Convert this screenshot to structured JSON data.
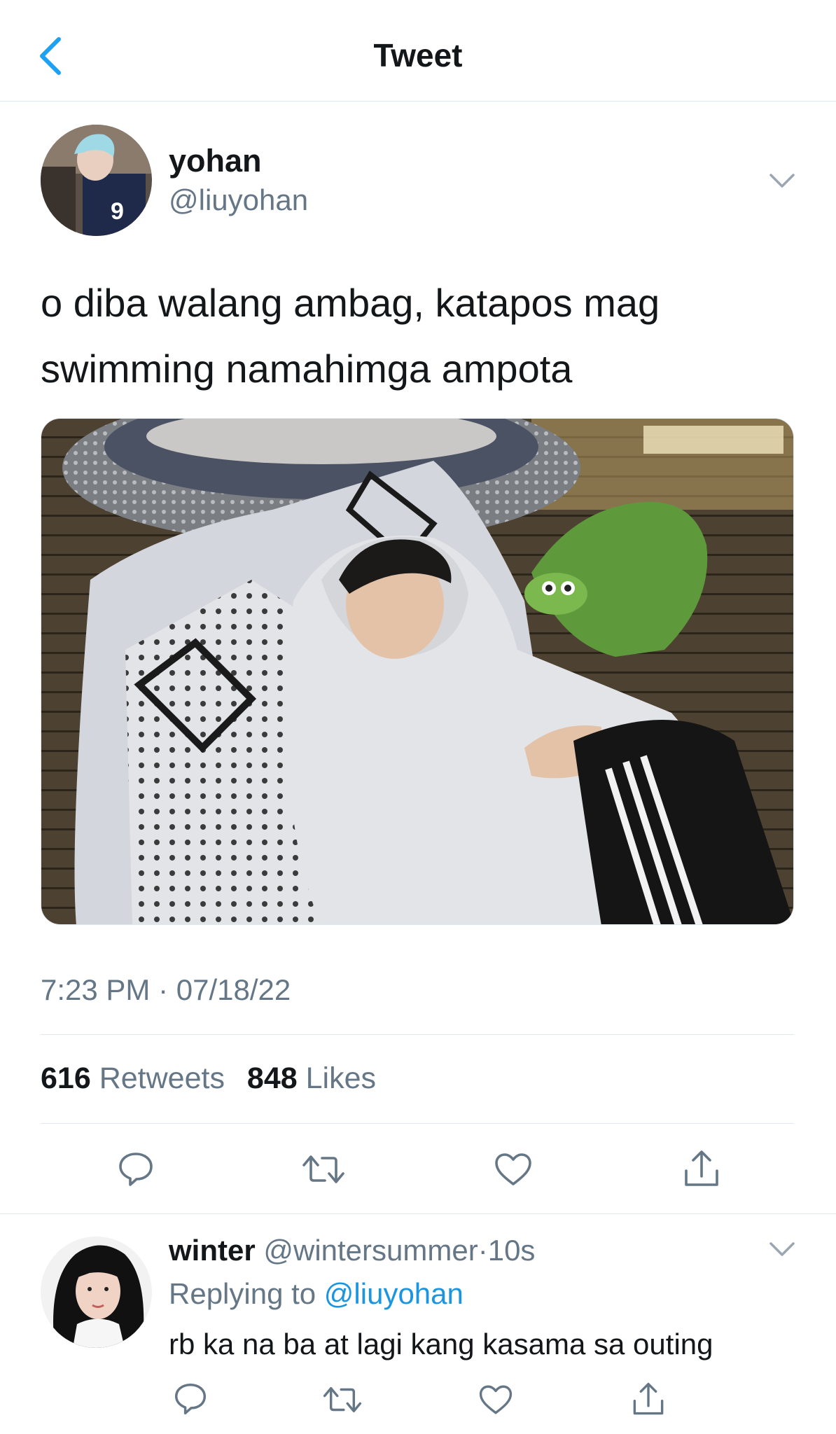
{
  "header": {
    "title": "Tweet"
  },
  "tweet": {
    "display_name": "yohan",
    "handle": "@liuyohan",
    "text_line1": "o diba walang ambag, katapos mag",
    "text_line2": "swimming namahimga ampota",
    "timestamp": "7:23 PM · 07/18/22",
    "retweets_count": "616",
    "retweets_label": "Retweets",
    "likes_count": "848",
    "likes_label": "Likes"
  },
  "reply": {
    "display_name": "winter",
    "handle": "@wintersummer",
    "dot": "·",
    "time": "10s",
    "replying_prefix": "Replying to",
    "replying_mention": "@liuyohan",
    "text": "rb ka na ba at lagi kang kasama sa outing"
  },
  "icons": {
    "back": "chevron-left-icon",
    "more": "chevron-down-icon",
    "reply": "comment-icon",
    "retweet": "retweet-icon",
    "like": "heart-icon",
    "share": "share-icon"
  },
  "colors": {
    "accent": "#1da1f2",
    "mention": "#1b95e0",
    "text": "#14171a",
    "secondary": "#657786",
    "divider": "#e1e8ed"
  }
}
